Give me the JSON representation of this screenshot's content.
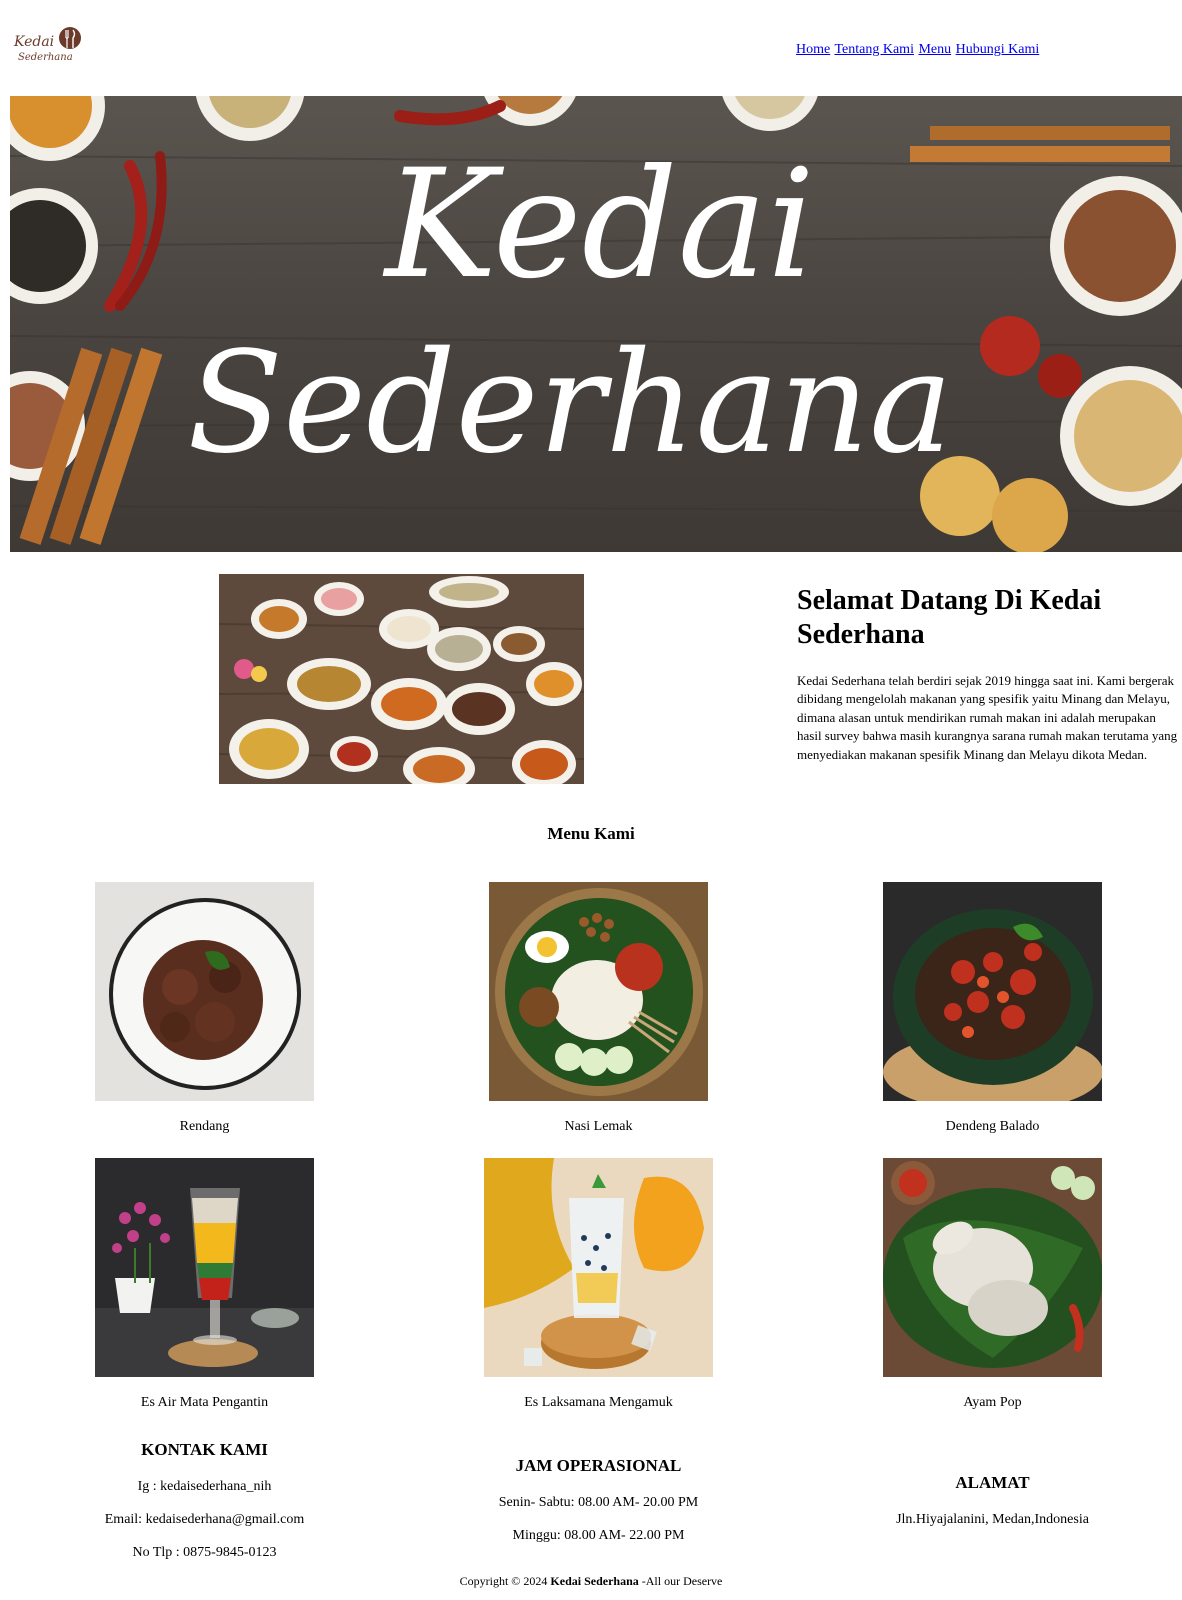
{
  "brand": {
    "logo_line1": "Kedai",
    "logo_line2": "Sederhana"
  },
  "nav": {
    "home": "Home",
    "about": "Tentang Kami",
    "menu": "Menu",
    "contact": "Hubungi Kami"
  },
  "hero": {
    "line1": "Kedai",
    "line2": "Sederhana"
  },
  "welcome": {
    "title": "Selamat Datang Di Kedai Sederhana",
    "body": "Kedai Sederhana telah berdiri sejak 2019 hingga saat ini. Kami bergerak dibidang mengelolah makanan yang spesifik yaitu Minang dan Melayu, dimana alasan untuk mendirikan rumah makan ini adalah merupakan hasil survey bahwa masih kurangnya sarana rumah makan terutama yang menyediakan makanan spesifik Minang dan Melayu dikota Medan."
  },
  "menu": {
    "title": "Menu Kami",
    "items": [
      {
        "name": "Rendang"
      },
      {
        "name": "Nasi Lemak"
      },
      {
        "name": "Dendeng Balado"
      },
      {
        "name": "Es Air Mata Pengantin"
      },
      {
        "name": "Es Laksamana Mengamuk"
      },
      {
        "name": "Ayam Pop"
      }
    ]
  },
  "contact": {
    "kontak": {
      "title": "KONTAK KAMI",
      "ig": "Ig : kedaisederhana_nih",
      "email": "Email: kedaisederhana@gmail.com",
      "phone": "No Tlp : 0875-9845-0123"
    },
    "jam": {
      "title": "JAM OPERASIONAL",
      "weekday": "Senin- Sabtu: 08.00 AM- 20.00 PM",
      "sunday": "Minggu: 08.00 AM- 22.00 PM"
    },
    "alamat": {
      "title": "ALAMAT",
      "address": "Jln.Hiyajalanini, Medan,Indonesia"
    }
  },
  "footer": {
    "prefix": "Copyright © 2024",
    "brand": "Kedai Sederhana",
    "suffix": "-All our Deserve"
  },
  "colors": {
    "link": "#0000ee",
    "wood": "#4a4440",
    "brand_brown": "#6b3a2a"
  }
}
